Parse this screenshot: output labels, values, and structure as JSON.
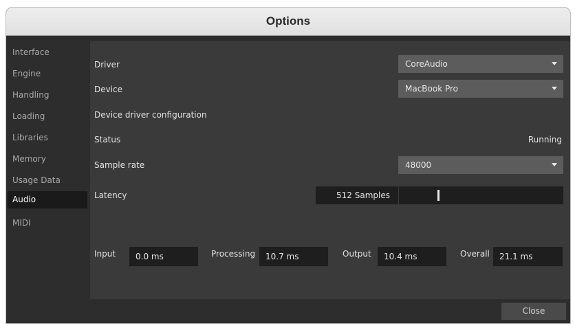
{
  "window": {
    "title": "Options"
  },
  "sidebar": {
    "items": [
      {
        "label": "Interface"
      },
      {
        "label": "Engine"
      },
      {
        "label": "Handling"
      },
      {
        "label": "Loading"
      },
      {
        "label": "Libraries"
      },
      {
        "label": "Memory"
      },
      {
        "label": "Usage Data"
      },
      {
        "label": "Audio"
      },
      {
        "label": "MIDI"
      }
    ],
    "selected": "Audio"
  },
  "audio": {
    "driver": {
      "label": "Driver",
      "value": "CoreAudio"
    },
    "device": {
      "label": "Device",
      "value": "MacBook Pro"
    },
    "device_config": {
      "label": "Device driver configuration"
    },
    "status": {
      "label": "Status",
      "value": "Running"
    },
    "sample_rate": {
      "label": "Sample rate",
      "value": "48000"
    },
    "latency": {
      "label": "Latency",
      "value": "512 Samples"
    },
    "stats": {
      "input": {
        "label": "Input",
        "value": "0.0 ms"
      },
      "processing": {
        "label": "Processing",
        "value": "10.7 ms"
      },
      "output": {
        "label": "Output",
        "value": "10.4 ms"
      },
      "overall": {
        "label": "Overall",
        "value": "21.1 ms"
      }
    }
  },
  "footer": {
    "close_label": "Close"
  },
  "colors": {
    "panel_bg": "#3a3a3a",
    "sidebar_bg": "#2d2d2d",
    "field_bg": "#1e1e1e",
    "dropdown_bg": "#5c5c5c"
  }
}
